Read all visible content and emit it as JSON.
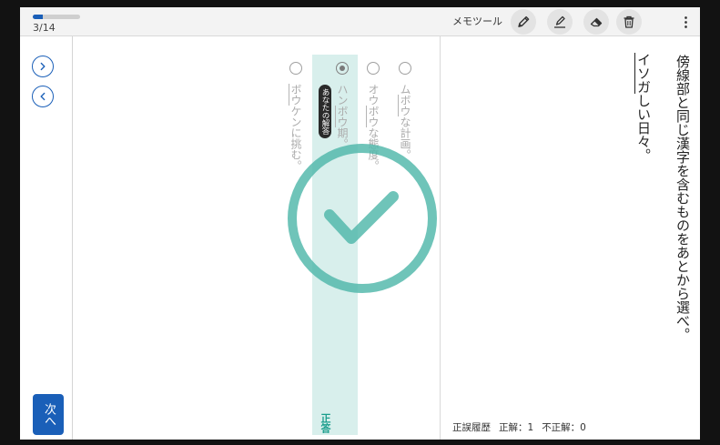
{
  "progress": {
    "label": "3/14",
    "current": 3,
    "total": 14
  },
  "toolbar": {
    "memo_label": "メモツール",
    "tools": [
      {
        "icon": "pencil-icon"
      },
      {
        "icon": "highlighter-icon"
      },
      {
        "icon": "eraser-icon"
      },
      {
        "icon": "trash-icon"
      }
    ],
    "more_icon": "more-vertical-icon"
  },
  "sidebar": {
    "forward_icon": "chevron-right-icon",
    "back_icon": "chevron-left-icon",
    "next_label": "次へ"
  },
  "question": {
    "prompt": "傍線部と同じ漢字を含むものをあとから選べ。",
    "stem": {
      "before": "",
      "marked": "イソガ",
      "after": "しい日々。"
    }
  },
  "choices": [
    {
      "before": "ム",
      "marked": "ボウ",
      "after": "な計画。",
      "selected": false
    },
    {
      "before": "オウ",
      "marked": "ボウ",
      "after": "な態度。",
      "selected": false
    },
    {
      "before": "ハン",
      "marked": "ボウ",
      "after": "期。",
      "selected": true
    },
    {
      "before": "",
      "marked": "ボウ",
      "after": "ケンに挑む。",
      "selected": false
    }
  ],
  "result": {
    "your_answer_badge": "あなたの解答",
    "correct_label": "正答",
    "outcome_icon": "check-circle-icon"
  },
  "history": {
    "label": "正誤履歴",
    "correct": "正解：1",
    "incorrect": "不正解：0"
  },
  "colors": {
    "accent": "#1a5fb8",
    "correct": "#4fb7a9",
    "correct_text": "#1a9d8c",
    "highlight": "#d8efec",
    "frame": "#121212"
  }
}
